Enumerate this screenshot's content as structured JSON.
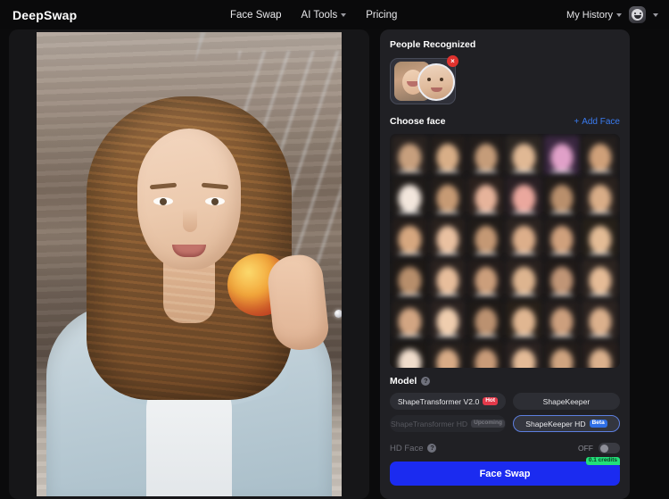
{
  "header": {
    "logo": "DeepSwap",
    "nav": [
      {
        "label": "Face Swap",
        "has_chevron": false
      },
      {
        "label": "AI Tools",
        "has_chevron": true
      },
      {
        "label": "Pricing",
        "has_chevron": false
      }
    ],
    "history_label": "My History"
  },
  "panel": {
    "people_recognized_title": "People Recognized",
    "delete_badge": "×",
    "choose_face_title": "Choose face",
    "add_face_label": "Add Face",
    "add_face_plus": "+",
    "model_title": "Model",
    "help_glyph": "?",
    "models": [
      {
        "label": "ShapeTransformer V2.0",
        "badge": "Hot",
        "badge_type": "hot",
        "selected": false,
        "disabled": false
      },
      {
        "label": "ShapeKeeper",
        "badge": "",
        "badge_type": "",
        "selected": false,
        "disabled": false
      },
      {
        "label": "ShapeTransformer HD",
        "badge": "Upcoming",
        "badge_type": "upcoming",
        "selected": false,
        "disabled": true
      },
      {
        "label": "ShapeKeeper HD",
        "badge": "Beta",
        "badge_type": "beta",
        "selected": true,
        "disabled": false
      }
    ],
    "hd_face_label": "HD Face",
    "hd_face_state": "OFF",
    "cta_label": "Face Swap",
    "credits_label": "0.1 credits"
  },
  "colors": {
    "accent_blue": "#1b2bf0",
    "link_blue": "#3a7bf0",
    "badge_hot": "#e3394a",
    "badge_beta": "#2f6fe6",
    "credits_green": "#22e07a",
    "panel_bg": "#202024",
    "page_bg": "#0b0b0c"
  },
  "face_grid": {
    "columns": 6,
    "rows": 6,
    "cells": [
      {
        "bg": "#2a2320",
        "blob": "#c79f7d"
      },
      {
        "bg": "#241e1b",
        "blob": "#d8ae87"
      },
      {
        "bg": "#211c1a",
        "blob": "#c59c79"
      },
      {
        "bg": "#2c2622",
        "blob": "#e0b894"
      },
      {
        "bg": "#3a2740",
        "blob": "#e0a0c8"
      },
      {
        "bg": "#241f1d",
        "blob": "#cfa079"
      },
      {
        "bg": "#1f1b19",
        "blob": "#f2e6dc"
      },
      {
        "bg": "#231d1a",
        "blob": "#c69a74"
      },
      {
        "bg": "#2b211d",
        "blob": "#e6b39a"
      },
      {
        "bg": "#2a2024",
        "blob": "#eaa79d"
      },
      {
        "bg": "#221c19",
        "blob": "#b98f6c"
      },
      {
        "bg": "#2a221e",
        "blob": "#d9ad87"
      },
      {
        "bg": "#241d1a",
        "blob": "#d6a77f"
      },
      {
        "bg": "#29211d",
        "blob": "#e9c0a0"
      },
      {
        "bg": "#201b18",
        "blob": "#c49874"
      },
      {
        "bg": "#2b2320",
        "blob": "#dcae8a"
      },
      {
        "bg": "#231d1b",
        "blob": "#cfa07c"
      },
      {
        "bg": "#262019",
        "blob": "#e3bb95"
      },
      {
        "bg": "#1e1916",
        "blob": "#b78e6b"
      },
      {
        "bg": "#2a221f",
        "blob": "#e7bd9b"
      },
      {
        "bg": "#231c1a",
        "blob": "#cb9e7b"
      },
      {
        "bg": "#29211e",
        "blob": "#ddb48f"
      },
      {
        "bg": "#201a18",
        "blob": "#c09576"
      },
      {
        "bg": "#2c2420",
        "blob": "#e5bb96"
      },
      {
        "bg": "#231e1b",
        "blob": "#d2a582"
      },
      {
        "bg": "#2a2220",
        "blob": "#efcdae"
      },
      {
        "bg": "#1f1a17",
        "blob": "#bb9170"
      },
      {
        "bg": "#282019",
        "blob": "#e0b691"
      },
      {
        "bg": "#241e1c",
        "blob": "#cc9f7d"
      },
      {
        "bg": "#2b2320",
        "blob": "#dbb08c"
      },
      {
        "bg": "#1d1916",
        "blob": "#f0ddcc"
      },
      {
        "bg": "#251f1c",
        "blob": "#d8ab86"
      },
      {
        "bg": "#221c19",
        "blob": "#c89b78"
      },
      {
        "bg": "#2a2220",
        "blob": "#e4bb97"
      },
      {
        "bg": "#231d1a",
        "blob": "#cfa480"
      },
      {
        "bg": "#271f1c",
        "blob": "#dbb18d"
      }
    ]
  }
}
